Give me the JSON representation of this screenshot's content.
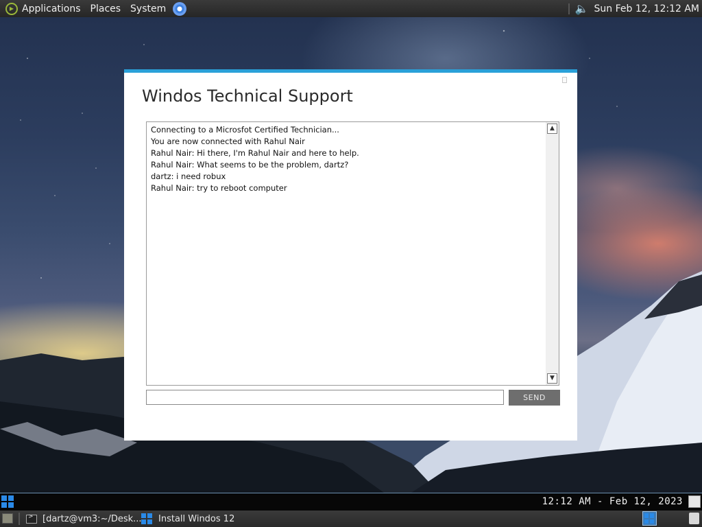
{
  "top_panel": {
    "menus": [
      "Applications",
      "Places",
      "System"
    ],
    "clock": "Sun Feb 12, 12:12 AM"
  },
  "window": {
    "title": "Windos Technical Support",
    "chat_lines": [
      "Connecting to a Microsfot Certified Technician...",
      "You are now connected with Rahul Nair",
      "Rahul Nair: Hi there, I'm Rahul Nair and here to help.",
      "Rahul Nair: What seems to be the problem, dartz?",
      "dartz: i need robux",
      "Rahul Nair: try to reboot computer"
    ],
    "message_input": {
      "value": "",
      "placeholder": ""
    },
    "send_label": "SEND"
  },
  "bottom_strip": {
    "datetime": "12:12 AM - Feb 12, 2023"
  },
  "taskbar": {
    "tasks": [
      {
        "label": "[dartz@vm3:~/Desk..."
      },
      {
        "label": "Install Windos 12"
      }
    ]
  },
  "colors": {
    "accent": "#2aa0d8",
    "send_button": "#6e6e6e",
    "windows_blue": "#2a8ae8"
  },
  "icons": {
    "panel_logo": "distro-logo-icon",
    "browser": "chrome-icon",
    "volume": "speaker-icon",
    "start": "windows-logo-icon",
    "terminal": "terminal-icon",
    "show_desktop": "show-desktop-icon",
    "trash": "trash-icon"
  }
}
